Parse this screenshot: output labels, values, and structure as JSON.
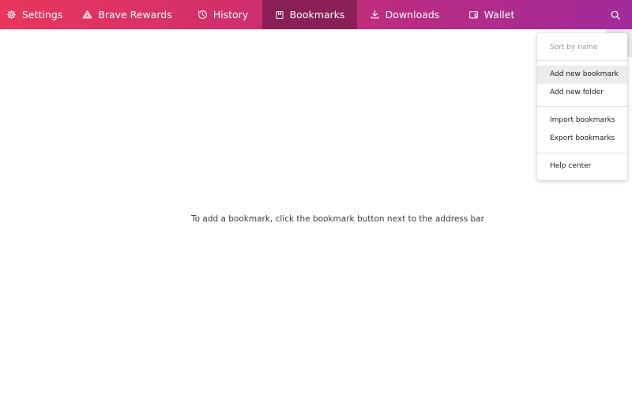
{
  "nav": {
    "tabs": [
      {
        "label": "Settings",
        "icon": "gear-icon"
      },
      {
        "label": "Brave Rewards",
        "icon": "rewards-triangle-icon"
      },
      {
        "label": "History",
        "icon": "history-clock-icon"
      },
      {
        "label": "Bookmarks",
        "icon": "bookmark-icon",
        "active": true
      },
      {
        "label": "Downloads",
        "icon": "download-icon"
      },
      {
        "label": "Wallet",
        "icon": "wallet-icon"
      }
    ],
    "search_icon": "search-icon",
    "gradient_colors": [
      "#e8365d",
      "#a12a9a"
    ],
    "active_tab_color": "#8a1f57"
  },
  "main": {
    "empty_message": "To add a bookmark, click the bookmark button next to the address bar"
  },
  "menu": {
    "sort_by_name": "Sort by name",
    "add_new_bookmark": "Add new bookmark",
    "add_new_folder": "Add new folder",
    "import_bookmarks": "Import bookmarks",
    "export_bookmarks": "Export bookmarks",
    "help_center": "Help center"
  }
}
